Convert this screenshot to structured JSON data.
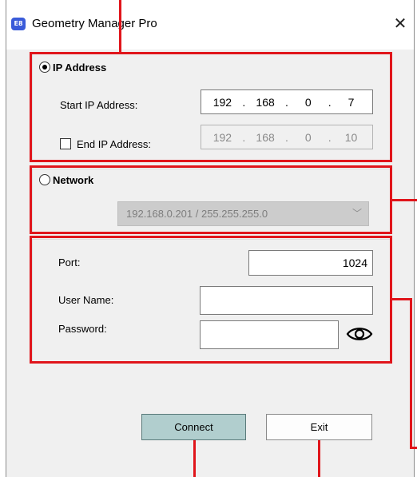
{
  "window": {
    "app_icon": "app-logo-icon",
    "app_icon_text": "E8",
    "title": "Geometry Manager Pro",
    "close_glyph": "✕"
  },
  "ip_section": {
    "radio_label": "IP Address",
    "selected": true,
    "start_label": "Start IP Address:",
    "start_ip": [
      "192",
      "168",
      "0",
      "7"
    ],
    "end_label": "End IP Address:",
    "end_checked": false,
    "end_ip": [
      "192",
      "168",
      "0",
      "10"
    ],
    "separator": "."
  },
  "network_section": {
    "radio_label": "Network",
    "selected": false,
    "selected_value": "192.168.0.201 / 255.255.255.0",
    "chevron": "﹀"
  },
  "credentials": {
    "port_label": "Port:",
    "port_value": "1024",
    "username_label": "User Name:",
    "username_value": "",
    "password_label": "Password:",
    "password_value": "",
    "show_password_icon": "eye-icon"
  },
  "buttons": {
    "connect": "Connect",
    "exit": "Exit"
  },
  "highlight_color": "#e0151b"
}
